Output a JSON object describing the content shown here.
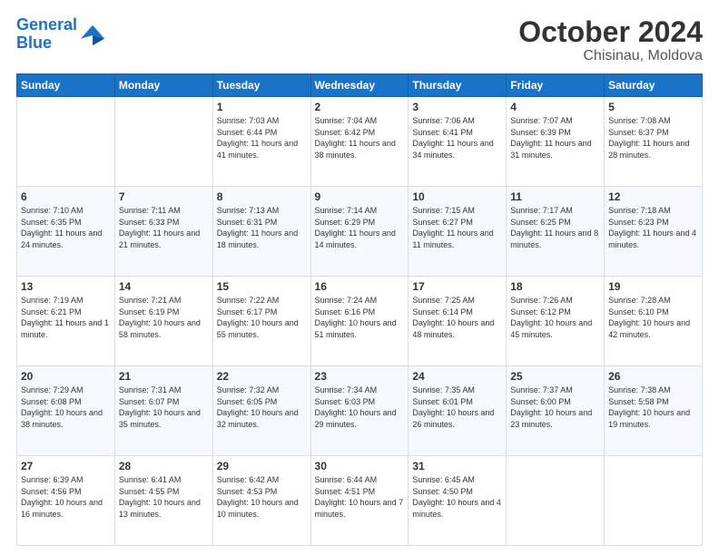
{
  "header": {
    "logo_line1": "General",
    "logo_line2": "Blue",
    "month_title": "October 2024",
    "location": "Chisinau, Moldova"
  },
  "weekdays": [
    "Sunday",
    "Monday",
    "Tuesday",
    "Wednesday",
    "Thursday",
    "Friday",
    "Saturday"
  ],
  "weeks": [
    [
      {
        "day": "",
        "info": ""
      },
      {
        "day": "",
        "info": ""
      },
      {
        "day": "1",
        "info": "Sunrise: 7:03 AM\nSunset: 6:44 PM\nDaylight: 11 hours and 41 minutes."
      },
      {
        "day": "2",
        "info": "Sunrise: 7:04 AM\nSunset: 6:42 PM\nDaylight: 11 hours and 38 minutes."
      },
      {
        "day": "3",
        "info": "Sunrise: 7:06 AM\nSunset: 6:41 PM\nDaylight: 11 hours and 34 minutes."
      },
      {
        "day": "4",
        "info": "Sunrise: 7:07 AM\nSunset: 6:39 PM\nDaylight: 11 hours and 31 minutes."
      },
      {
        "day": "5",
        "info": "Sunrise: 7:08 AM\nSunset: 6:37 PM\nDaylight: 11 hours and 28 minutes."
      }
    ],
    [
      {
        "day": "6",
        "info": "Sunrise: 7:10 AM\nSunset: 6:35 PM\nDaylight: 11 hours and 24 minutes."
      },
      {
        "day": "7",
        "info": "Sunrise: 7:11 AM\nSunset: 6:33 PM\nDaylight: 11 hours and 21 minutes."
      },
      {
        "day": "8",
        "info": "Sunrise: 7:13 AM\nSunset: 6:31 PM\nDaylight: 11 hours and 18 minutes."
      },
      {
        "day": "9",
        "info": "Sunrise: 7:14 AM\nSunset: 6:29 PM\nDaylight: 11 hours and 14 minutes."
      },
      {
        "day": "10",
        "info": "Sunrise: 7:15 AM\nSunset: 6:27 PM\nDaylight: 11 hours and 11 minutes."
      },
      {
        "day": "11",
        "info": "Sunrise: 7:17 AM\nSunset: 6:25 PM\nDaylight: 11 hours and 8 minutes."
      },
      {
        "day": "12",
        "info": "Sunrise: 7:18 AM\nSunset: 6:23 PM\nDaylight: 11 hours and 4 minutes."
      }
    ],
    [
      {
        "day": "13",
        "info": "Sunrise: 7:19 AM\nSunset: 6:21 PM\nDaylight: 11 hours and 1 minute."
      },
      {
        "day": "14",
        "info": "Sunrise: 7:21 AM\nSunset: 6:19 PM\nDaylight: 10 hours and 58 minutes."
      },
      {
        "day": "15",
        "info": "Sunrise: 7:22 AM\nSunset: 6:17 PM\nDaylight: 10 hours and 55 minutes."
      },
      {
        "day": "16",
        "info": "Sunrise: 7:24 AM\nSunset: 6:16 PM\nDaylight: 10 hours and 51 minutes."
      },
      {
        "day": "17",
        "info": "Sunrise: 7:25 AM\nSunset: 6:14 PM\nDaylight: 10 hours and 48 minutes."
      },
      {
        "day": "18",
        "info": "Sunrise: 7:26 AM\nSunset: 6:12 PM\nDaylight: 10 hours and 45 minutes."
      },
      {
        "day": "19",
        "info": "Sunrise: 7:28 AM\nSunset: 6:10 PM\nDaylight: 10 hours and 42 minutes."
      }
    ],
    [
      {
        "day": "20",
        "info": "Sunrise: 7:29 AM\nSunset: 6:08 PM\nDaylight: 10 hours and 38 minutes."
      },
      {
        "day": "21",
        "info": "Sunrise: 7:31 AM\nSunset: 6:07 PM\nDaylight: 10 hours and 35 minutes."
      },
      {
        "day": "22",
        "info": "Sunrise: 7:32 AM\nSunset: 6:05 PM\nDaylight: 10 hours and 32 minutes."
      },
      {
        "day": "23",
        "info": "Sunrise: 7:34 AM\nSunset: 6:03 PM\nDaylight: 10 hours and 29 minutes."
      },
      {
        "day": "24",
        "info": "Sunrise: 7:35 AM\nSunset: 6:01 PM\nDaylight: 10 hours and 26 minutes."
      },
      {
        "day": "25",
        "info": "Sunrise: 7:37 AM\nSunset: 6:00 PM\nDaylight: 10 hours and 23 minutes."
      },
      {
        "day": "26",
        "info": "Sunrise: 7:38 AM\nSunset: 5:58 PM\nDaylight: 10 hours and 19 minutes."
      }
    ],
    [
      {
        "day": "27",
        "info": "Sunrise: 6:39 AM\nSunset: 4:56 PM\nDaylight: 10 hours and 16 minutes."
      },
      {
        "day": "28",
        "info": "Sunrise: 6:41 AM\nSunset: 4:55 PM\nDaylight: 10 hours and 13 minutes."
      },
      {
        "day": "29",
        "info": "Sunrise: 6:42 AM\nSunset: 4:53 PM\nDaylight: 10 hours and 10 minutes."
      },
      {
        "day": "30",
        "info": "Sunrise: 6:44 AM\nSunset: 4:51 PM\nDaylight: 10 hours and 7 minutes."
      },
      {
        "day": "31",
        "info": "Sunrise: 6:45 AM\nSunset: 4:50 PM\nDaylight: 10 hours and 4 minutes."
      },
      {
        "day": "",
        "info": ""
      },
      {
        "day": "",
        "info": ""
      }
    ]
  ]
}
